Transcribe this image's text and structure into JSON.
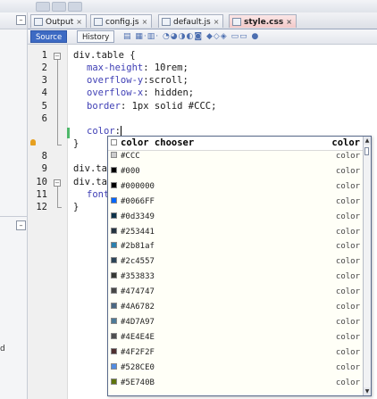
{
  "tabs": [
    {
      "label": "Output",
      "close": "×",
      "active": false
    },
    {
      "label": "config.js",
      "close": "×",
      "active": false
    },
    {
      "label": "default.js",
      "close": "×",
      "active": false
    },
    {
      "label": "style.css",
      "close": "×",
      "active": true
    }
  ],
  "source_bar": {
    "source": "Source",
    "history": "History"
  },
  "left_panel": {
    "minimize_glyph": "–",
    "restore_glyph": "–",
    "hint": "d"
  },
  "line_numbers": [
    "1",
    "2",
    "3",
    "4",
    "5",
    "6",
    "7",
    "8",
    "9",
    "10",
    "11",
    "12"
  ],
  "code": {
    "l1": "div.table {",
    "l2p": "max-height",
    "l2v": ": 10rem;",
    "l3p": "overflow-y",
    "l3v": ":scroll;",
    "l4p": "overflow-x",
    "l4v": ": hidden;",
    "l5p": "border",
    "l5v": ": 1px solid #CCC;",
    "l6p": "color",
    "l6v": ":",
    "l7": "}",
    "l9": "div.ta",
    "l10": "div.ta",
    "l11": "font",
    "l12": "}"
  },
  "completion": {
    "header_name": "color chooser",
    "header_type": "color",
    "items": [
      {
        "name": "#CCC",
        "type": "color",
        "swatch": "#CCCCCC"
      },
      {
        "name": "#000",
        "type": "color",
        "swatch": "#000000"
      },
      {
        "name": "#000000",
        "type": "color",
        "swatch": "#000000"
      },
      {
        "name": "#0066FF",
        "type": "color",
        "swatch": "#0066FF"
      },
      {
        "name": "#0d3349",
        "type": "color",
        "swatch": "#0d3349"
      },
      {
        "name": "#253441",
        "type": "color",
        "swatch": "#253441"
      },
      {
        "name": "#2b81af",
        "type": "color",
        "swatch": "#2b81af"
      },
      {
        "name": "#2c4557",
        "type": "color",
        "swatch": "#2c4557"
      },
      {
        "name": "#353833",
        "type": "color",
        "swatch": "#353833"
      },
      {
        "name": "#474747",
        "type": "color",
        "swatch": "#474747"
      },
      {
        "name": "#4A6782",
        "type": "color",
        "swatch": "#4A6782"
      },
      {
        "name": "#4D7A97",
        "type": "color",
        "swatch": "#4D7A97"
      },
      {
        "name": "#4E4E4E",
        "type": "color",
        "swatch": "#4E4E4E"
      },
      {
        "name": "#4F2F2F",
        "type": "color",
        "swatch": "#4F2F2F"
      },
      {
        "name": "#528CE0",
        "type": "color",
        "swatch": "#528CE0"
      },
      {
        "name": "#5E740B",
        "type": "color",
        "swatch": "#5E740B"
      }
    ]
  }
}
